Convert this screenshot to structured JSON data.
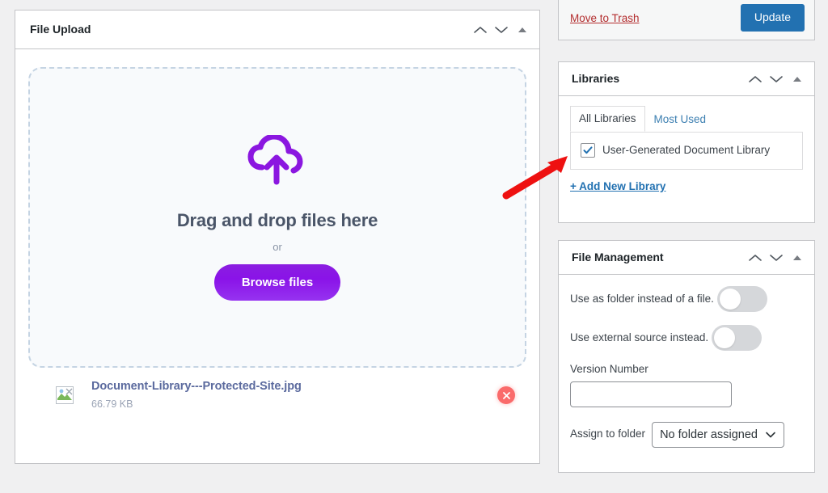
{
  "colors": {
    "accent_purple": "#8b17e0",
    "wp_blue": "#2271b1",
    "trash_red": "#b32d2e",
    "remove_red": "#fa6b6b",
    "page_bg": "#f0f0f1",
    "annotation_red": "#ee1111"
  },
  "file_upload": {
    "title": "File Upload",
    "order_up_icon": "chevron-up-icon",
    "order_down_icon": "chevron-down-icon",
    "collapse_icon": "triangle-up-icon",
    "dropzone": {
      "upload_icon": "cloud-upload-icon",
      "title": "Drag and drop files here",
      "or": "or",
      "browse_label": "Browse files"
    },
    "files": [
      {
        "thumb_icon": "broken-image-icon",
        "name": "Document-Library---Protected-Site.jpg",
        "size": "66.79 KB",
        "remove_icon": "close-circle-icon"
      }
    ]
  },
  "publish": {
    "trash_label": "Move to Trash",
    "update_label": "Update"
  },
  "libraries": {
    "title": "Libraries",
    "order_up_icon": "chevron-up-icon",
    "order_down_icon": "chevron-down-icon",
    "collapse_icon": "triangle-up-icon",
    "tabs": [
      {
        "label": "All Libraries",
        "active": true
      },
      {
        "label": "Most Used",
        "active": false
      }
    ],
    "items": [
      {
        "label": "User-Generated Document Library",
        "checked": true
      }
    ],
    "add_new_label": "+ Add New Library"
  },
  "file_management": {
    "title": "File Management",
    "order_up_icon": "chevron-up-icon",
    "order_down_icon": "chevron-down-icon",
    "collapse_icon": "triangle-up-icon",
    "toggles": [
      {
        "label": "Use as folder instead of a file.",
        "on": false
      },
      {
        "label": "Use external source instead.",
        "on": false
      }
    ],
    "version": {
      "label": "Version Number",
      "value": "",
      "placeholder": ""
    },
    "assign_folder": {
      "label": "Assign to folder",
      "selected": "No folder assigned",
      "caret_icon": "chevron-down-icon"
    }
  },
  "annotation": {
    "arrow_icon": "arrow-pointing-upright-icon"
  }
}
